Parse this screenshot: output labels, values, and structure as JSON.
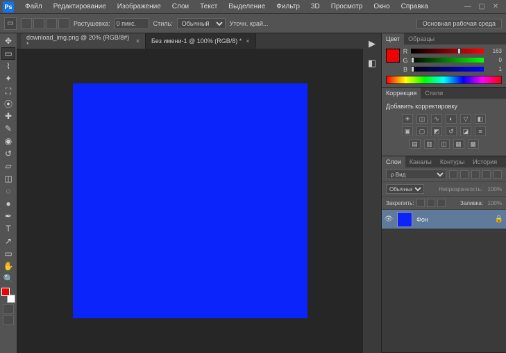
{
  "menubar": {
    "items": [
      "Файл",
      "Редактирование",
      "Изображение",
      "Слои",
      "Текст",
      "Выделение",
      "Фильтр",
      "3D",
      "Просмотр",
      "Окно",
      "Справка"
    ]
  },
  "options_bar": {
    "feather_label": "Растушевка:",
    "feather_value": "0 пикс.",
    "style_label": "Стиль:",
    "style_value": "Обычный",
    "refine_label": "Уточн. край...",
    "workspace": "Основная рабочая среда"
  },
  "tabs": [
    {
      "label": "download_img.png @ 20% (RGB/8#) *"
    },
    {
      "label": "Без имени-1 @ 100% (RGB/8) *"
    }
  ],
  "canvas_color": "#0b24fb",
  "color_panel": {
    "tabs": [
      "Цвет",
      "Образцы"
    ],
    "channels": [
      {
        "name": "R",
        "value": 163,
        "class": "r",
        "pos": 64
      },
      {
        "name": "G",
        "value": 0,
        "class": "g",
        "pos": 0
      },
      {
        "name": "B",
        "value": 1,
        "class": "b",
        "pos": 0
      }
    ]
  },
  "korr_panel": {
    "tabs": [
      "Коррекция",
      "Стили"
    ],
    "title": "Добавить корректировку"
  },
  "layers_panel": {
    "tabs": [
      "Слои",
      "Каналы",
      "Контуры",
      "История"
    ],
    "filter_label": "ρ Вид",
    "blend_mode": "Обычные",
    "opacity_label": "Непрозрачность:",
    "opacity_value": "100%",
    "lock_label": "Закрепить:",
    "fill_label": "Заливка:",
    "fill_value": "100%",
    "layers": [
      {
        "name": "Фон"
      }
    ]
  }
}
